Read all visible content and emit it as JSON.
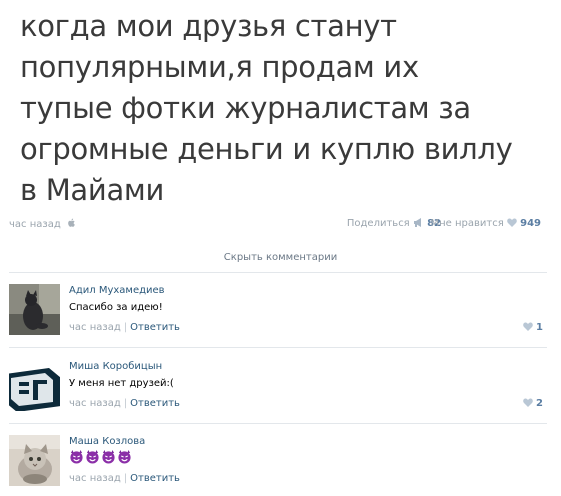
{
  "post": {
    "lines": [
      "когда мои друзья станут",
      "популярными,я продам их",
      "тупые фотки журналистам за",
      "огромные деньги и куплю виллу",
      "в Майами"
    ],
    "time": "час назад",
    "share_label": "Поделиться",
    "share_count": "82",
    "like_label": "Мне нравится",
    "like_count": "949"
  },
  "hide_comments_label": "Скрыть комментарии",
  "comments": [
    {
      "author": "Адил Мухамедиев",
      "text": "Спасибо за идею!",
      "time": "час назад",
      "reply": "Ответить",
      "likes": "1",
      "avatar_icon": "cat-photo"
    },
    {
      "author": "Миша Коробицын",
      "text": "У меня нет друзей:(",
      "time": "час назад",
      "reply": "Ответить",
      "likes": "2",
      "avatar_icon": "logo-3d"
    },
    {
      "author": "Маша Козлова",
      "text": "",
      "emojis": [
        "devil-emoji",
        "devil-emoji",
        "devil-emoji",
        "devil-emoji"
      ],
      "time": "час назад",
      "reply": "Ответить",
      "likes": "",
      "avatar_icon": "kitten-photo"
    }
  ],
  "colors": {
    "link": "#2b587a",
    "muted": "#9aa4ad",
    "accent": "#5b7ea3",
    "emoji": "#8b2fa8"
  }
}
